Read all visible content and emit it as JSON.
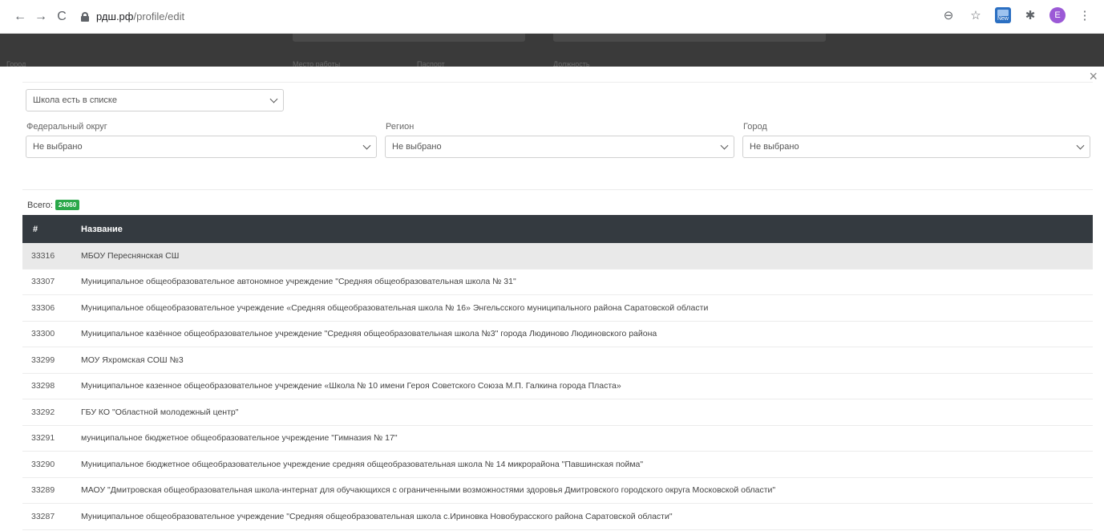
{
  "browser": {
    "url_host": "рдш.рф",
    "url_path": "/profile/edit",
    "ext_new_label": "New",
    "avatar_letter": "E",
    "back_glyph": "←",
    "forward_glyph": "→",
    "reload_glyph": "C",
    "zoom_glyph": "⊖",
    "star_glyph": "☆",
    "puzzle_glyph": "✱",
    "menu_glyph": "⋮"
  },
  "background_page": {
    "labels": [
      "Город",
      "Место работы",
      "Паспорт",
      "Должность"
    ]
  },
  "modal": {
    "close_glyph": "×",
    "school_mode_select": "Школа есть в списке",
    "filters": {
      "district_label": "Федеральный округ",
      "district_value": "Не выбрано",
      "region_label": "Регион",
      "region_value": "Не выбрано",
      "city_label": "Город",
      "city_value": "Не выбрано"
    },
    "total_label": "Всего:",
    "total_count": "24060",
    "table": {
      "headers": [
        "#",
        "Название"
      ],
      "rows": [
        {
          "id": "33316",
          "name": "МБОУ Переснянская СШ"
        },
        {
          "id": "33307",
          "name": "Муниципальное общеобразовательное автономное учреждение \"Средняя общеобразовательная школа № 31\""
        },
        {
          "id": "33306",
          "name": "Муниципальное общеобразовательное учреждение «Средняя общеобразовательная школа № 16» Энгельсского муниципального района Саратовской области"
        },
        {
          "id": "33300",
          "name": "Муниципальное казённое общеобразовательное учреждение \"Средняя общеобразовательная школа №3\" города Людиново Людиновского района"
        },
        {
          "id": "33299",
          "name": "МОУ Яхромская СОШ №3"
        },
        {
          "id": "33298",
          "name": "Муниципальное казенное общеобразовательное учреждение «Школа № 10 имени Героя Советского Союза М.П. Галкина города Пласта»"
        },
        {
          "id": "33292",
          "name": "ГБУ КО \"Областной молодежный центр\""
        },
        {
          "id": "33291",
          "name": "муниципальное бюджетное общеобразовательное учреждение \"Гимназия № 17\""
        },
        {
          "id": "33290",
          "name": "Муниципальное бюджетное общеобразовательное учреждение средняя общеобразовательная школа № 14 микрорайона \"Павшинская пойма\""
        },
        {
          "id": "33289",
          "name": "МАОУ \"Дмитровская общеобразовательная школа-интернат для обучающихся с ограниченными возможностями здоровья Дмитровского городского округа Московской области\""
        },
        {
          "id": "33287",
          "name": "Муниципальное общеобразовательное учреждение \"Средняя общеобразовательная школа с.Ириновка Новобурасского района Саратовской области\""
        }
      ]
    }
  }
}
